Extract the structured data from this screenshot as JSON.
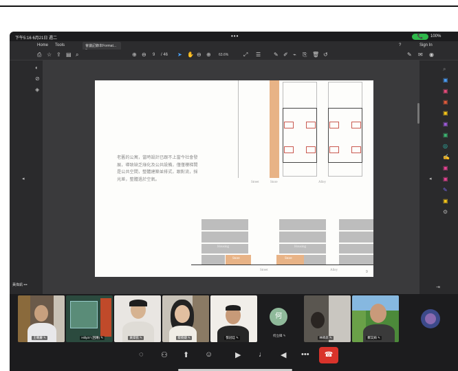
{
  "status": {
    "time_date": "下午5:16 6月21日 週二",
    "battery": "100%",
    "call": "📞",
    "center_dots": "•••"
  },
  "tabs": {
    "home": "Home",
    "tools": "Tools",
    "doc": "會議記錄本Format... ×",
    "help": "?",
    "signin": "Sign In"
  },
  "toolbar": {
    "page_current": "9",
    "page_total": "/ 46",
    "zoom": "63.6%"
  },
  "document": {
    "caption": "老舊的公寓，當時設計已跟不上當今社會發展，導致缺乏綠化及公共設備，僅僅樓梯間是公共空間，整體建築並排式，跟對流，採光差，整體過於空氣。",
    "plan_labels": [
      "Street",
      "Store",
      "Alley"
    ],
    "elevation_labels": {
      "housing": "Housing",
      "store": "Store",
      "street": "Street",
      "alley": "Alley"
    },
    "page_number": "9"
  },
  "participant_label": "黃偉凱 •••",
  "participants": [
    {
      "name": "王朝慶 ✎"
    },
    {
      "name": "Hilly37 (回應) ✎"
    },
    {
      "name": "黃偉凱 ✎"
    },
    {
      "name": "蔡筱婕 ✎"
    },
    {
      "name": "張冠廷 ✎"
    },
    {
      "name": "何立緯 ✎",
      "initial": "何"
    },
    {
      "name": "林筱庭 ✎"
    },
    {
      "name": "鄭又綺 ✎"
    }
  ],
  "controls": [
    "chat-icon",
    "participants-icon",
    "share-icon",
    "reaction-icon",
    "camera-off-icon",
    "mic-off-icon",
    "speaker-icon",
    "more-icon",
    "end-call-icon"
  ],
  "colors": {
    "accent_orange": "#e8b386",
    "end_red": "#d9332b",
    "call_green": "#2fb84a"
  }
}
